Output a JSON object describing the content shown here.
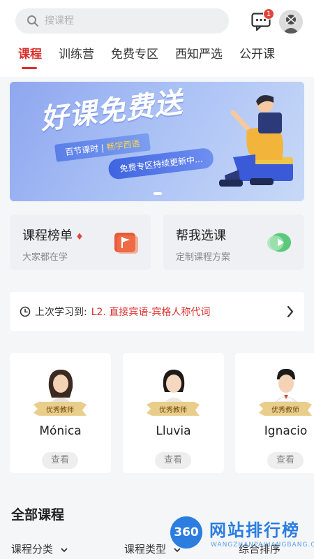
{
  "search": {
    "placeholder": "搜课程"
  },
  "header": {
    "message_badge": "1"
  },
  "tabs": [
    {
      "label": "课程",
      "active": true
    },
    {
      "label": "训练营"
    },
    {
      "label": "免费专区"
    },
    {
      "label": "西知严选"
    },
    {
      "label": "公开课"
    }
  ],
  "banner": {
    "title": "好课免费送",
    "tag_left": "百节课时",
    "tag_right": "畅学西语",
    "subtitle": "免费专区持续更新中..."
  },
  "cards": [
    {
      "title": "课程榜单",
      "subtitle": "大家都在学"
    },
    {
      "title": "帮我选课",
      "subtitle": "定制课程方案"
    }
  ],
  "last_study": {
    "label": "上次学习到:",
    "value": "L2. 直接宾语-宾格人称代词"
  },
  "teachers": [
    {
      "badge": "优秀教师",
      "name": "Mónica",
      "button": "查看"
    },
    {
      "badge": "优秀教师",
      "name": "Lluvia",
      "button": "查看"
    },
    {
      "badge": "优秀教师",
      "name": "Ignacio",
      "button": "查看"
    }
  ],
  "all_courses": {
    "title": "全部课程"
  },
  "filters": [
    {
      "label": "课程分类"
    },
    {
      "label": "课程类型"
    },
    {
      "label": "综合排序"
    }
  ],
  "watermark": {
    "badge": "360",
    "title": "网站排行榜",
    "url": "WANGZHANPAIHANGBANG.CN"
  },
  "colors": {
    "accent": "#d9302c",
    "page_bg": "#f5f6f8",
    "card_bg": "#eef0f4",
    "watermark": "#2b7de0"
  }
}
